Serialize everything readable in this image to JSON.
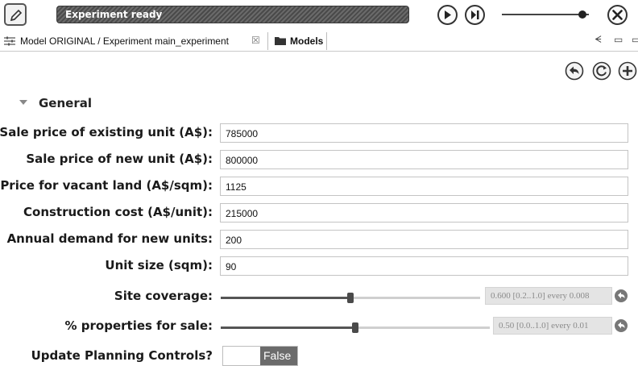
{
  "toolbar": {
    "edit_icon": "pencil-icon",
    "status_text": "Experiment ready",
    "run_icon": "play-icon",
    "step_icon": "step-forward-icon",
    "speed_level": 0.93,
    "close_icon": "close-icon"
  },
  "tabs": {
    "experiment_tab_label": "Model ORIGINAL / Experiment main_experiment",
    "experiment_tab_icon": "properties-icon",
    "close_glyph": "☒",
    "models_tab_label": "Models",
    "models_tab_icon": "folder-icon",
    "minimize_glyph": "ᗕ",
    "restore_glyph": "▭",
    "maximize_glyph": "▭"
  },
  "actions": {
    "back_icon": "undo-icon",
    "refresh_icon": "refresh-icon",
    "add_icon": "add-icon"
  },
  "section": {
    "title": "General"
  },
  "fields": [
    {
      "label": "Sale price of existing unit (A$):",
      "value": "785000"
    },
    {
      "label": "Sale price of new unit (A$):",
      "value": "800000"
    },
    {
      "label": "Price for vacant land (A$/sqm):",
      "value": "1125"
    },
    {
      "label": "Construction cost (A$/unit):",
      "value": "215000"
    },
    {
      "label": "Annual demand for new units:",
      "value": "200"
    },
    {
      "label": "Unit size (sqm):",
      "value": "90"
    }
  ],
  "sliders": [
    {
      "label": "Site coverage:",
      "value": 0.6,
      "min": 0.2,
      "max": 1.0,
      "readout": "0.600 [0.2..1.0] every 0.008"
    },
    {
      "label": "% properties for sale:",
      "value": 0.5,
      "min": 0.0,
      "max": 1.0,
      "readout": "0.50 [0.0..1.0] every 0.01"
    }
  ],
  "toggle": {
    "label": "Update Planning Controls?",
    "value_label": "False"
  },
  "colors": {
    "status_bar": "#5a5a5a",
    "slider_fill": "#555555",
    "toggle_active": "#6b6b6b"
  }
}
